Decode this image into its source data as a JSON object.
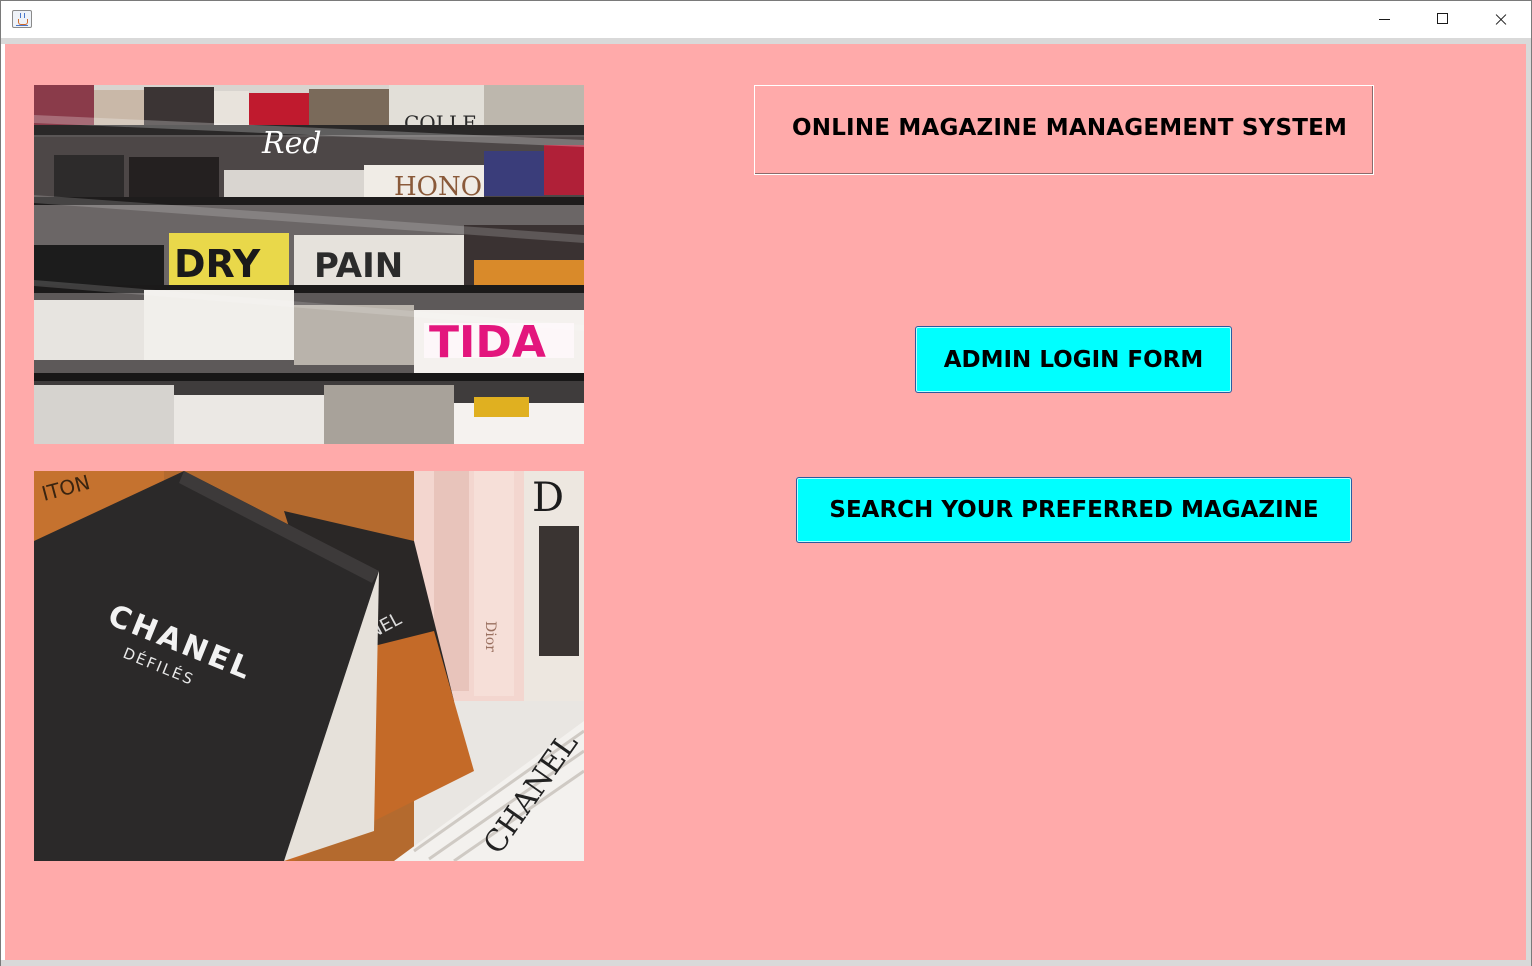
{
  "window": {
    "app_icon": "java-coffee-cup-icon",
    "controls": [
      "minimize-icon",
      "maximize-icon",
      "close-icon"
    ]
  },
  "main": {
    "title": "ONLINE MAGAZINE MANAGEMENT SYSTEM",
    "admin_button_label": "ADMIN LOGIN FORM",
    "search_button_label": "SEARCH YOUR PREFERRED MAGAZINE"
  },
  "images": {
    "photo1_lettering": [
      "Red",
      "COLLE",
      "HONO",
      "DRY",
      "PAIN",
      "TIDA"
    ],
    "photo2_lettering": [
      "CHANEL",
      "DÉFILÉS",
      "ITON",
      "NEL",
      "DIOR",
      "CHANEL"
    ]
  },
  "colors": {
    "background": "#ffaaaa",
    "button": "#00ffff",
    "title_border": "#ffffff"
  }
}
